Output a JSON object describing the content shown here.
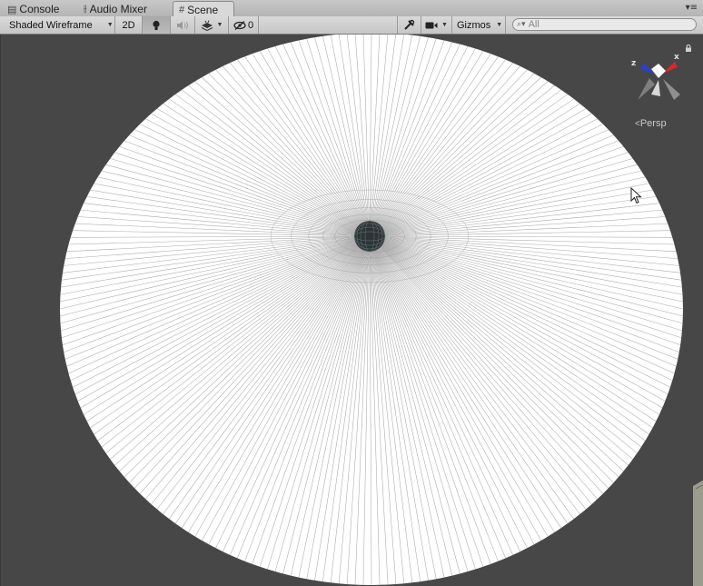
{
  "tabs": [
    {
      "label": "Console",
      "icon": "console-icon",
      "active": false
    },
    {
      "label": "Audio Mixer",
      "icon": "audio-mixer-icon",
      "active": false
    },
    {
      "label": "Scene",
      "icon": "scene-grid-icon",
      "active": true
    }
  ],
  "toolbar": {
    "shading_mode": "Shaded Wireframe",
    "mode_2d": "2D",
    "hidden_count": "0",
    "gizmos_label": "Gizmos",
    "search_placeholder": "All"
  },
  "scene": {
    "camera_mode": "Persp",
    "gizmo_axes": {
      "z": "z",
      "x": "x"
    },
    "colors": {
      "background": "#474747",
      "disc": "#ffffff",
      "wire": "#8c8c8c",
      "axis_z": "#2a3fd6",
      "axis_x": "#d62a2a"
    }
  }
}
